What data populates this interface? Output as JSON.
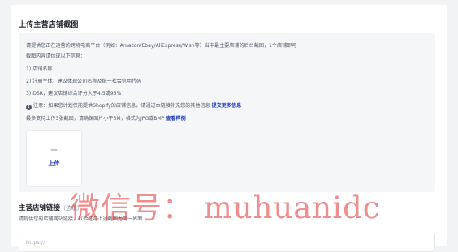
{
  "section": {
    "title": "上传主营店铺截图"
  },
  "info": {
    "line1": "请提供您正在运营的跨境电商平台（例如：Amazon/Ebay/AliExpress/Wish等）当中最主要店铺的后台截图，1个店铺即可",
    "line2": "截图内容请体现以下信息：",
    "line3": "1) 店铺名称",
    "line4": "2) 注册主体，建议体现公司名称及统一社会信用代码",
    "line5": "3) DSR，建议店铺综合评分大于4.5或95%",
    "notice_prefix": "注意：如果您计划仅能提供Shopify的店铺信息，请通过本链接补充您的其他信息",
    "notice_link": "提交更多信息",
    "limit_text": "最多支持上传3张截图，请确保图片小于5M，格式为JPG或BMP",
    "limit_link": "查看样例",
    "notice_icon": "info-icon"
  },
  "upload": {
    "plus": "+",
    "label": "上传"
  },
  "store_link": {
    "title": "主营店铺链接",
    "optional": "（选填）",
    "description": "请提供您的店铺网站链接，以验证与上述截图为同一界面",
    "placeholder": "https://"
  },
  "watermark": {
    "text": "微信号： muhuanidc"
  },
  "colors": {
    "link": "#1d39c4",
    "watermark": "#e23232",
    "info_bg": "#f5f6f7"
  }
}
